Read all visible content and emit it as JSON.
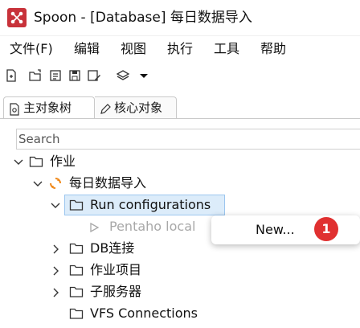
{
  "window": {
    "title": "Spoon - [Database] 每日数据导入"
  },
  "menu": {
    "items": [
      "文件(F)",
      "编辑",
      "视图",
      "执行",
      "工具",
      "帮助"
    ]
  },
  "tabs": [
    {
      "label": "主对象树"
    },
    {
      "label": "核心对象"
    }
  ],
  "search": {
    "placeholder": "Search"
  },
  "tree": {
    "root": "作业",
    "job": "每日数据导入",
    "run_configurations": "Run configurations",
    "pentaho_local": "Pentaho local",
    "db_connections": "DB连接",
    "job_items": "作业项目",
    "slave_servers": "子服务器",
    "vfs_connections": "VFS Connections"
  },
  "context_menu": {
    "new_label": "New..."
  },
  "annotation": {
    "step": "1"
  },
  "colors": {
    "accent": "#c8323a",
    "selection": "#dcecfa",
    "badge": "#e03030"
  }
}
